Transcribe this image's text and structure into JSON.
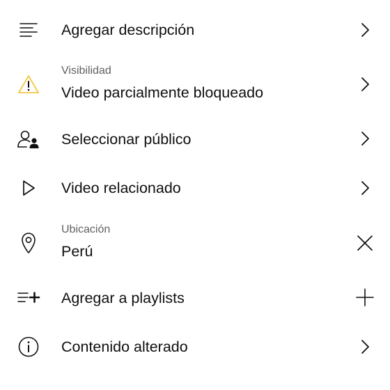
{
  "colors": {
    "text_primary": "#0f0f0f",
    "text_secondary": "#606060",
    "warning": "#f2c744",
    "background": "#ffffff"
  },
  "items": [
    {
      "icon": "description-lines-icon",
      "label": "Agregar descripción",
      "trailing": "chevron-right-icon"
    },
    {
      "icon": "warning-triangle-icon",
      "sublabel": "Visibilidad",
      "label": "Video parcialmente bloqueado",
      "trailing": "chevron-right-icon"
    },
    {
      "icon": "audience-person-icon",
      "label": "Seleccionar público",
      "trailing": "chevron-right-icon"
    },
    {
      "icon": "play-outline-icon",
      "label": "Video relacionado",
      "trailing": "chevron-right-icon"
    },
    {
      "icon": "location-pin-icon",
      "sublabel": "Ubicación",
      "label": "Perú",
      "trailing": "close-icon"
    },
    {
      "icon": "playlist-add-icon",
      "label": "Agregar a playlists",
      "trailing": "plus-icon"
    },
    {
      "icon": "info-circle-icon",
      "label": "Contenido alterado",
      "trailing": "chevron-right-icon"
    }
  ]
}
